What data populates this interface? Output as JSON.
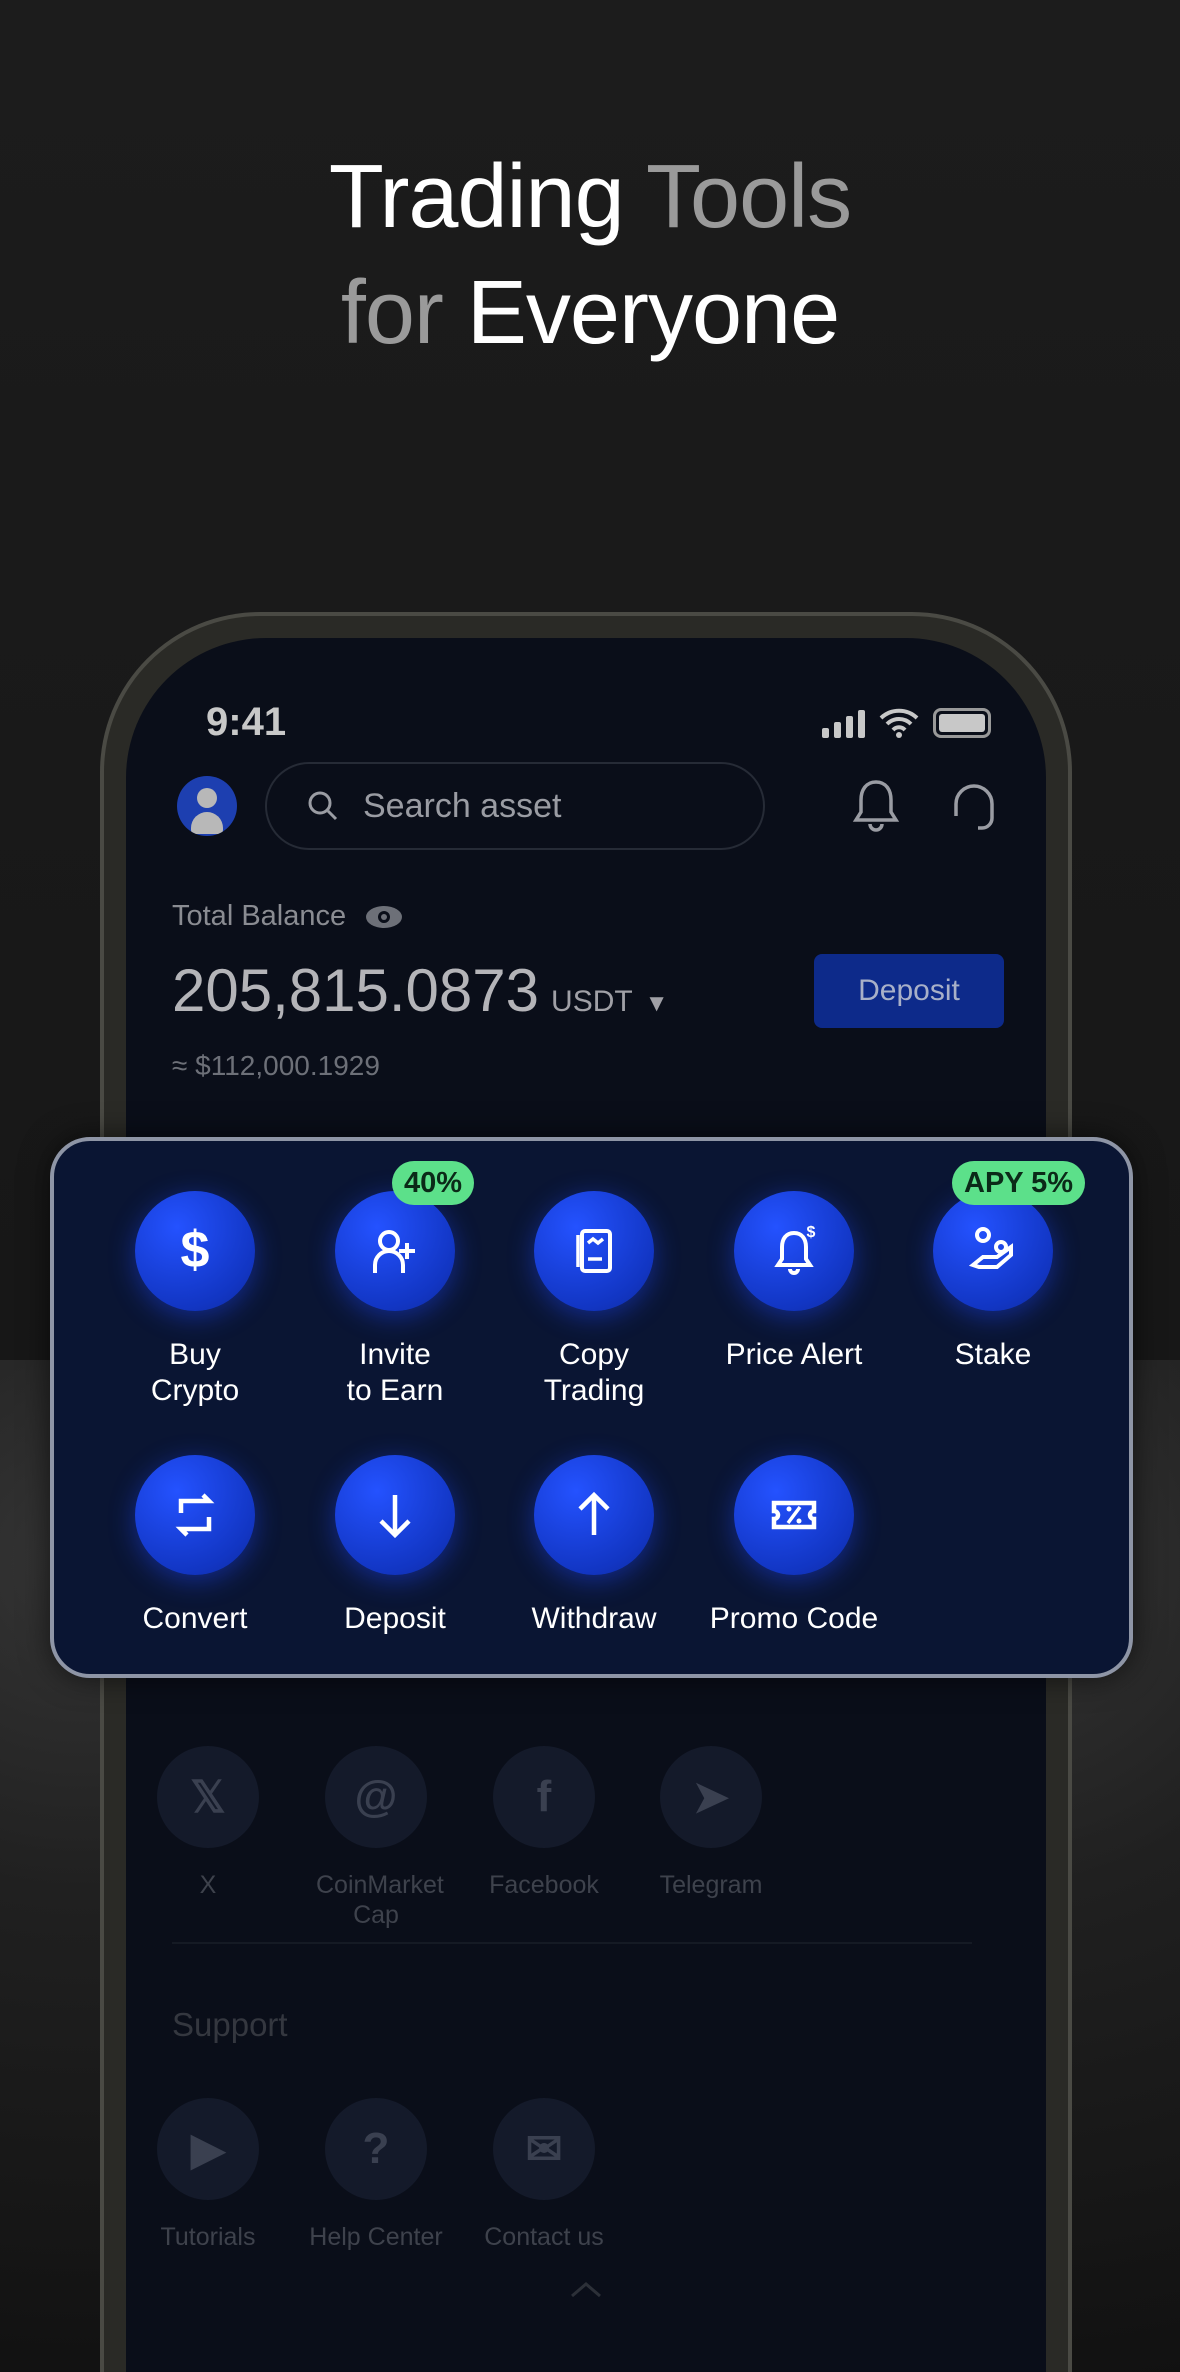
{
  "headline": {
    "line1_a": "Trading",
    "line1_b": "Tools",
    "line2_a": "for",
    "line2_b": "Everyone"
  },
  "status_bar": {
    "time": "9:41"
  },
  "header": {
    "search_placeholder": "Search asset"
  },
  "balance": {
    "label": "Total Balance",
    "amount": "205,815.0873",
    "currency": "USDT",
    "fiat": "≈ $112,000.1929",
    "deposit_label": "Deposit"
  },
  "tools": [
    {
      "label1": "Buy",
      "label2": "Crypto",
      "icon": "dollar-icon"
    },
    {
      "label1": "Invite",
      "label2": "to Earn",
      "icon": "add-user-icon",
      "badge": "40%"
    },
    {
      "label1": "Copy",
      "label2": "Trading",
      "icon": "copy-trading-icon"
    },
    {
      "label1": "Price Alert",
      "label2": "",
      "icon": "price-alert-icon"
    },
    {
      "label1": "Stake",
      "label2": "",
      "icon": "stake-icon",
      "badge": "APY 5%"
    },
    {
      "label1": "Convert",
      "label2": "",
      "icon": "convert-icon"
    },
    {
      "label1": "Deposit",
      "label2": "",
      "icon": "arrow-down-icon"
    },
    {
      "label1": "Withdraw",
      "label2": "",
      "icon": "arrow-up-icon"
    },
    {
      "label1": "Promo Code",
      "label2": "",
      "icon": "ticket-icon"
    }
  ],
  "social": [
    {
      "label": "X",
      "glyph": "𝕏"
    },
    {
      "label": "CoinMarket Cap",
      "glyph": "@"
    },
    {
      "label": "Facebook",
      "glyph": "f"
    },
    {
      "label": "Telegram",
      "glyph": "➤"
    }
  ],
  "support": {
    "title": "Support",
    "items": [
      {
        "label": "Tutorials"
      },
      {
        "label": "Help Center"
      },
      {
        "label": "Contact us"
      }
    ]
  },
  "colors": {
    "accent": "#1a44e8",
    "badge": "#5ce08a",
    "card_bg": "#0a1533"
  }
}
